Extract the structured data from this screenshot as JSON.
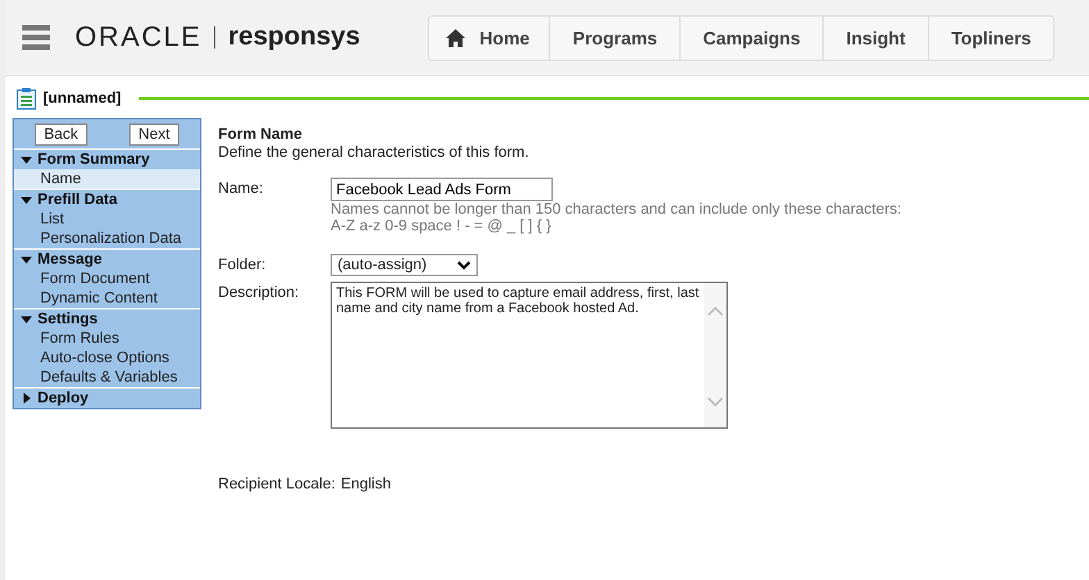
{
  "header": {
    "logo_brand": "ORACLE",
    "logo_product": "responsys",
    "nav": [
      {
        "label": "Home",
        "kind": "home",
        "selected": false
      },
      {
        "label": "Programs",
        "kind": "plain",
        "selected": false
      },
      {
        "label": "Campaigns",
        "kind": "plain",
        "selected": false
      },
      {
        "label": "Insight",
        "kind": "plain",
        "selected": false
      },
      {
        "label": "Topliners",
        "kind": "plain",
        "selected": false
      }
    ]
  },
  "page_title": "[unnamed]",
  "sidebar": {
    "buttons": [
      "Back",
      "Next"
    ],
    "sections": [
      {
        "label": "Form Summary",
        "expanded": true,
        "children": [
          {
            "label": "Name",
            "selected": true
          }
        ]
      },
      {
        "label": "Prefill Data",
        "expanded": true,
        "children": [
          {
            "label": "List",
            "selected": false
          },
          {
            "label": "Personalization Data",
            "selected": false
          }
        ]
      },
      {
        "label": "Message",
        "expanded": true,
        "children": [
          {
            "label": "Form Document",
            "selected": false
          },
          {
            "label": "Dynamic Content",
            "selected": false
          }
        ]
      },
      {
        "label": "Settings",
        "expanded": true,
        "children": [
          {
            "label": "Form Rules",
            "selected": false
          },
          {
            "label": "Auto-close Options",
            "selected": false
          },
          {
            "label": "Defaults & Variables",
            "selected": false
          }
        ]
      },
      {
        "label": "Deploy",
        "expanded": false
      }
    ]
  },
  "form": {
    "heading": "Form Name",
    "subheading": "Define the general characteristics of this form.",
    "name_label": "Name:",
    "name_value": "Facebook Lead Ads Form",
    "name_hint": [
      "Names cannot be longer than 150 characters and can include only these characters:",
      "A-Z a-z 0-9 space ! - = @ _ [ ] { }"
    ],
    "folder_label": "Folder:",
    "folder_value": "(auto-assign)",
    "description_label": "Description:",
    "description_value": "This FORM will be used to capture email address, first, last name and city name from a Facebook hosted Ad.",
    "locale_label": "Recipient Locale:",
    "locale_value": "English"
  }
}
